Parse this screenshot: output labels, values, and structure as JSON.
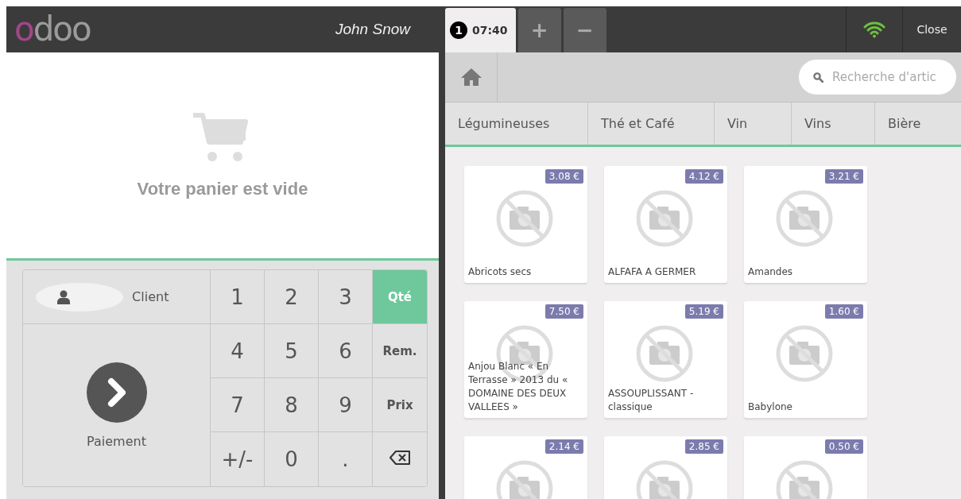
{
  "header": {
    "logo": "odoo",
    "cashier": "John Snow",
    "orders": [
      {
        "number": "1",
        "time": "07:40",
        "selected": true
      }
    ],
    "new_order": "+",
    "delete_order": "−",
    "close": "Close"
  },
  "cart": {
    "empty_message": "Votre panier est vide"
  },
  "actions": {
    "client": "Client",
    "payment": "Paiement"
  },
  "numpad": {
    "keys": [
      {
        "kind": "digit",
        "label": "1"
      },
      {
        "kind": "digit",
        "label": "2"
      },
      {
        "kind": "digit",
        "label": "3"
      },
      {
        "kind": "mode",
        "label": "Qté",
        "selected": true
      },
      {
        "kind": "digit",
        "label": "4"
      },
      {
        "kind": "digit",
        "label": "5"
      },
      {
        "kind": "digit",
        "label": "6"
      },
      {
        "kind": "mode",
        "label": "Rem.",
        "selected": false
      },
      {
        "kind": "digit",
        "label": "7"
      },
      {
        "kind": "digit",
        "label": "8"
      },
      {
        "kind": "digit",
        "label": "9"
      },
      {
        "kind": "mode",
        "label": "Prix",
        "selected": false
      },
      {
        "kind": "digit",
        "label": "+/-"
      },
      {
        "kind": "digit",
        "label": "0"
      },
      {
        "kind": "digit",
        "label": "."
      },
      {
        "kind": "backspace"
      }
    ]
  },
  "search": {
    "placeholder": "Recherche d'artic"
  },
  "categories": [
    "Légumineuses",
    "Thé et Café",
    "Vin",
    "Vins",
    "Bière"
  ],
  "products": [
    {
      "name": "Abricots secs",
      "price": "3.08 €"
    },
    {
      "name": "ALFAFA A GERMER",
      "price": "4.12 €"
    },
    {
      "name": "Amandes",
      "price": "3.21 €"
    },
    {
      "name": "Anjou Blanc « En Terrasse » 2013 du « DOMAINE DES DEUX VALLEES »",
      "price": "7.50 €"
    },
    {
      "name": "ASSOUPLISSANT - classique",
      "price": "5.19 €"
    },
    {
      "name": "Babylone",
      "price": "1.60 €"
    },
    {
      "price": "2.14 €"
    },
    {
      "price": "2.85 €"
    },
    {
      "price": "0.50 €"
    }
  ]
}
